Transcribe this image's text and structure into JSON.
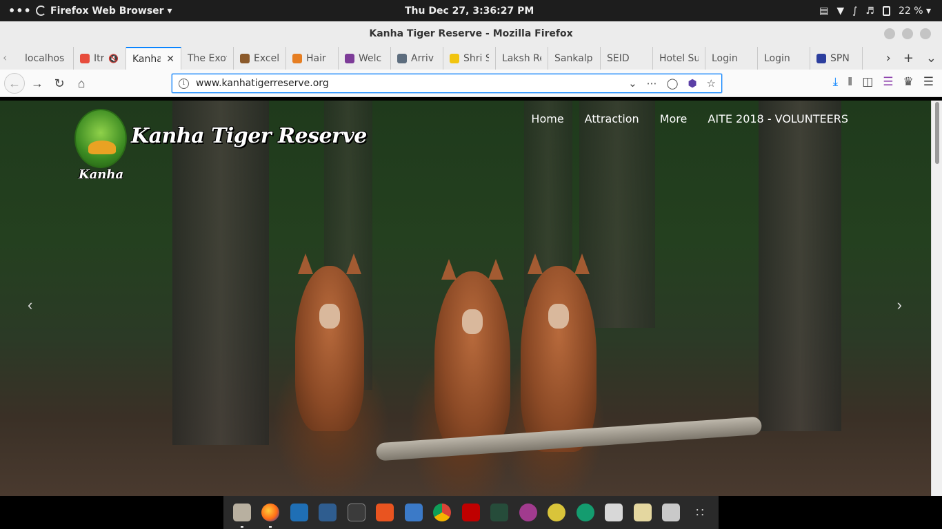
{
  "topbar": {
    "activities": "•••",
    "app_name": "Firefox Web Browser ▾",
    "clock": "Thu Dec 27,  3:36:27 PM",
    "battery": "22 % ▾"
  },
  "window": {
    "title": "Kanha Tiger Reserve - Mozilla Firefox"
  },
  "tabs": [
    {
      "label": "localhos",
      "favicon_color": "transparent"
    },
    {
      "label": "Itr",
      "favicon_color": "#e74c3c",
      "muted": "🔇"
    },
    {
      "label": "Kanha",
      "favicon_color": "transparent",
      "active": true,
      "close": "✕"
    },
    {
      "label": "The Exot",
      "favicon_color": "transparent"
    },
    {
      "label": "Excel",
      "favicon_color": "#8b5a2b"
    },
    {
      "label": "Hair",
      "favicon_color": "#e67e22"
    },
    {
      "label": "Welc",
      "favicon_color": "#7d3c98"
    },
    {
      "label": "Arriv",
      "favicon_color": "#5d6d7e"
    },
    {
      "label": "Shri S",
      "favicon_color": "#f1c40f"
    },
    {
      "label": "Laksh Re",
      "favicon_color": "transparent"
    },
    {
      "label": "Sankalp",
      "favicon_color": "transparent"
    },
    {
      "label": "SEID",
      "favicon_color": "transparent"
    },
    {
      "label": "Hotel Su",
      "favicon_color": "transparent"
    },
    {
      "label": "Login",
      "favicon_color": "transparent"
    },
    {
      "label": "Login",
      "favicon_color": "transparent"
    },
    {
      "label": "SPN",
      "favicon_color": "#2c3e9e"
    }
  ],
  "navbar": {
    "url": "www.kanhatigerreserve.org"
  },
  "site": {
    "logo_title": "Kanha Tiger Reserve",
    "logo_sub": "Kanha",
    "nav": [
      "Home",
      "Attraction",
      "More",
      "AITE 2018 - VOLUNTEERS"
    ],
    "prev": "‹",
    "next": "›"
  },
  "dock": [
    {
      "name": "files-icon",
      "cls": "ic-files",
      "running": true
    },
    {
      "name": "firefox-icon",
      "cls": "ic-firefox",
      "running": true
    },
    {
      "name": "vscode-icon",
      "cls": "ic-vscode"
    },
    {
      "name": "mysql-workbench-icon",
      "cls": "ic-workbench"
    },
    {
      "name": "terminal-icon",
      "cls": "ic-terminal"
    },
    {
      "name": "software-center-icon",
      "cls": "ic-software"
    },
    {
      "name": "writer-icon",
      "cls": "ic-writer"
    },
    {
      "name": "chrome-icon",
      "cls": "ic-chrome"
    },
    {
      "name": "filezilla-icon",
      "cls": "ic-filezilla"
    },
    {
      "name": "system-monitor-icon",
      "cls": "ic-monitor"
    },
    {
      "name": "vpn-icon",
      "cls": "ic-vpn"
    },
    {
      "name": "keyring-icon",
      "cls": "ic-keyring"
    },
    {
      "name": "gitkraken-icon",
      "cls": "ic-gitkraken"
    },
    {
      "name": "calculator-icon",
      "cls": "ic-calc"
    },
    {
      "name": "notes-icon",
      "cls": "ic-notes"
    },
    {
      "name": "tools-icon",
      "cls": "ic-tools"
    },
    {
      "name": "show-apps-icon",
      "cls": "ic-apps",
      "glyph": "∷"
    }
  ]
}
